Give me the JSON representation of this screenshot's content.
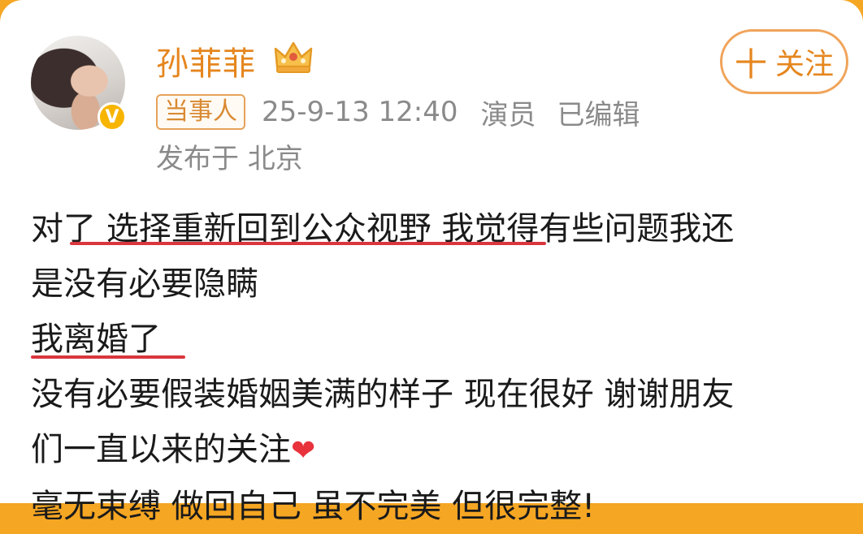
{
  "user": {
    "name": "孙菲菲",
    "badge": "当事人",
    "timestamp": "25-9-13 12:40",
    "role": "演员",
    "edited": "已编辑",
    "location": "发布于 北京",
    "follow_label": "关注",
    "follow_plus": "十"
  },
  "post": {
    "line1": "对了 选择重新回到公众视野 我觉得有些问题我还",
    "line2": "是没有必要隐瞒",
    "line3": "我离婚了",
    "line4": "没有必要假装婚姻美满的样子 现在很好 谢谢朋友",
    "line5": "们一直以来的关注",
    "line6": "毫无束缚 做回自己 虽不完美 但很完整!"
  },
  "colors": {
    "accent": "#e5861e",
    "underline": "#d9363e",
    "background_top": "#f5a623"
  },
  "icons": {
    "crown": "crown-icon",
    "verified": "verified-v-icon",
    "heart": "heart-icon"
  }
}
